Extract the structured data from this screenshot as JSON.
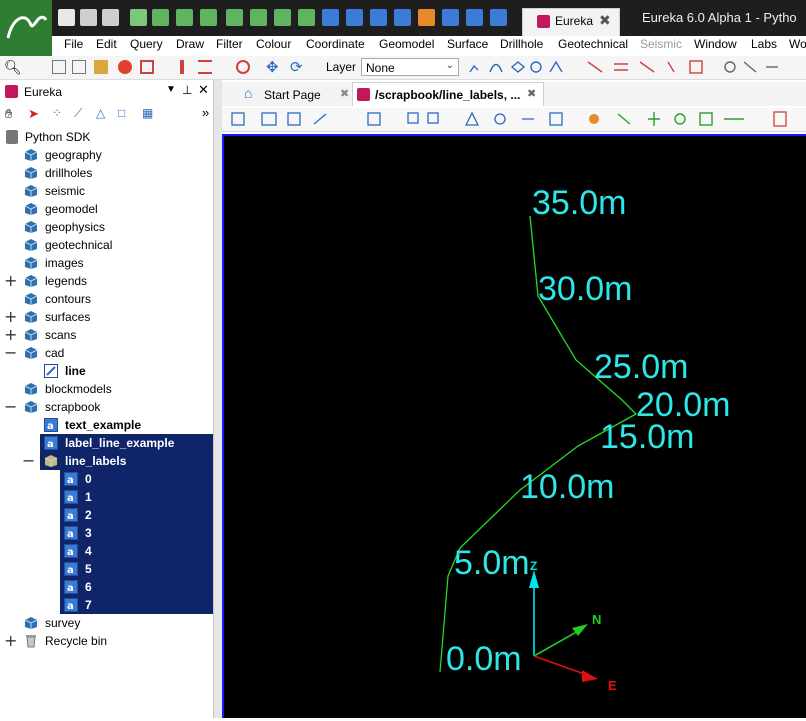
{
  "titlebar": {
    "tab_label": "Eureka",
    "window_title": "Eureka 6.0 Alpha 1 - Pytho"
  },
  "menubar": {
    "items": [
      "File",
      "Edit",
      "Query",
      "Draw",
      "Filter",
      "Colour",
      "Coordinate",
      "Geomodel",
      "Surface",
      "Drillhole",
      "Geotechnical",
      "Seismic",
      "Window",
      "Labs",
      "Wo"
    ]
  },
  "toolbar": {
    "layer_label": "Layer",
    "layer_value": "None"
  },
  "panel": {
    "title": "Eureka",
    "more_glyph": "»"
  },
  "tree": {
    "root": "Python SDK",
    "items": [
      {
        "label": "geography",
        "bold": false
      },
      {
        "label": "drillholes",
        "bold": false
      },
      {
        "label": "seismic",
        "bold": false
      },
      {
        "label": "geomodel",
        "bold": false
      },
      {
        "label": "geophysics",
        "bold": false
      },
      {
        "label": "geotechnical",
        "bold": false
      },
      {
        "label": "images",
        "bold": false
      },
      {
        "label": "legends",
        "bold": false
      },
      {
        "label": "contours",
        "bold": false
      },
      {
        "label": "surfaces",
        "bold": false
      },
      {
        "label": "scans",
        "bold": false
      },
      {
        "label": "cad",
        "bold": false
      },
      {
        "label": "line",
        "bold": true
      },
      {
        "label": "blockmodels",
        "bold": false
      },
      {
        "label": "scrapbook",
        "bold": false
      },
      {
        "label": "text_example",
        "bold": true
      },
      {
        "label": "label_line_example",
        "bold": true
      },
      {
        "label": "line_labels",
        "bold": true
      },
      {
        "label": "0",
        "bold": true
      },
      {
        "label": "1",
        "bold": true
      },
      {
        "label": "2",
        "bold": true
      },
      {
        "label": "3",
        "bold": true
      },
      {
        "label": "4",
        "bold": true
      },
      {
        "label": "5",
        "bold": true
      },
      {
        "label": "6",
        "bold": true
      },
      {
        "label": "7",
        "bold": true
      },
      {
        "label": "survey",
        "bold": false
      },
      {
        "label": "Recycle bin",
        "bold": false
      }
    ]
  },
  "doc_tabs": [
    {
      "label": "Start Page",
      "active": false
    },
    {
      "label": "/scrapbook/line_labels, ...",
      "active": true
    }
  ],
  "viewport": {
    "line_labels": [
      "0.0m",
      "5.0m",
      "10.0m",
      "15.0m",
      "20.0m",
      "25.0m",
      "30.0m",
      "35.0m"
    ],
    "axis_labels": {
      "z": "Z",
      "n": "N",
      "e": "E"
    },
    "colors": {
      "background": "#000000",
      "line": "#22dd22",
      "labels": "#2ee6e6",
      "z_axis": "#00e5e5",
      "n_axis": "#22cc22",
      "e_axis": "#e01010"
    }
  }
}
